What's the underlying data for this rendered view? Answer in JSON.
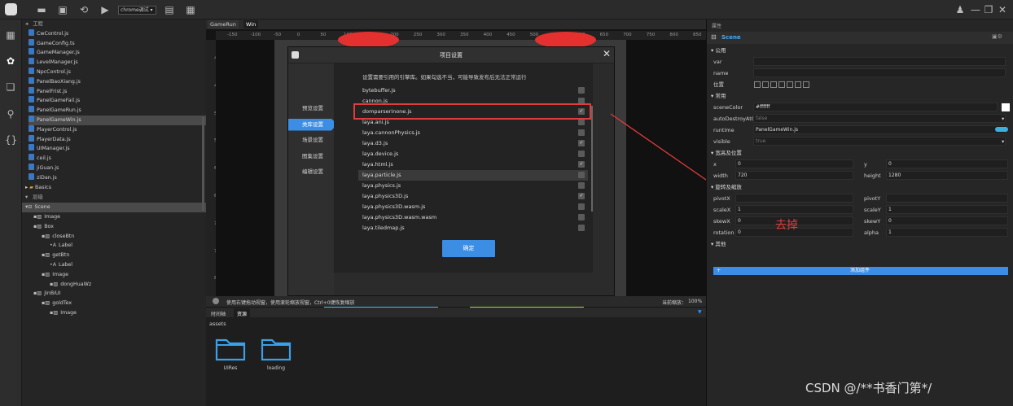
{
  "toolbar": {
    "run_target": "chrome调试 ▾"
  },
  "tree": {
    "section": "工程",
    "files": [
      "CwControl.js",
      "GameConfig.ts",
      "GameManager.js",
      "LevelManager.js",
      "NpcControl.js",
      "PanelBaoXiang.js",
      "PanelFrist.js",
      "PanelGameFail.js",
      "PanelGameRun.js",
      "PanelGameWin.js",
      "PlayerControl.js",
      "PlayerData.js",
      "UIManager.js",
      "ceil.js",
      "jiGuan.js",
      "ziDan.js"
    ],
    "folder": "Basics",
    "layer_section": "层级",
    "layers": [
      "Scene",
      "Image",
      "Box",
      "closeBtn",
      "Label",
      "getBtn",
      "Label",
      "Image",
      "dongHuaWz",
      "JinBiUI",
      "goldTex",
      "Image"
    ]
  },
  "tabs": [
    "GameRun",
    "Win"
  ],
  "ruler": [
    "-150",
    "-100",
    "-50",
    "0",
    "50",
    "100",
    "150",
    "200",
    "250",
    "300",
    "350",
    "400",
    "450",
    "500",
    "550",
    "600",
    "650",
    "700",
    "750",
    "800",
    "850"
  ],
  "vruler": [
    "400",
    "450",
    "500",
    "550",
    "600",
    "650",
    "700",
    "750",
    "800",
    "850"
  ],
  "dialog": {
    "title": "项目设置",
    "nav": [
      "预览设置",
      "类库设置",
      "场景设置",
      "图集设置",
      "编辑设置"
    ],
    "desc": "设置需要引用的引擎库。如果勾选不当，可能导致发布后无法正常运行",
    "libs": [
      [
        "bytebuffer.js",
        false
      ],
      [
        "cannon.js",
        false
      ],
      [
        "domparserinone.js",
        true
      ],
      [
        "laya.ani.js",
        false
      ],
      [
        "laya.cannonPhysics.js",
        false
      ],
      [
        "laya.d3.js",
        true
      ],
      [
        "laya.device.js",
        false
      ],
      [
        "laya.html.js",
        true
      ],
      [
        "laya.particle.js",
        false
      ],
      [
        "laya.physics.js",
        false
      ],
      [
        "laya.physics3D.js",
        true
      ],
      [
        "laya.physics3D.wasm.js",
        false
      ],
      [
        "laya.physics3D.wasm.wasm",
        false
      ],
      [
        "laya.tiledmap.js",
        false
      ]
    ],
    "ok": "确定"
  },
  "status": {
    "hint": "使用右键拖动视窗，使用滚轮缩放视窗，Ctrl+0键恢复缩放",
    "zoom_label": "当前缩放：",
    "zoom": "100%"
  },
  "bottom": {
    "tabs": [
      "时间轴",
      "资源"
    ],
    "path": "assets",
    "folders": [
      "UIRes",
      "loading"
    ]
  },
  "props": {
    "tab": "属性",
    "node": "Scene",
    "g1": "公用",
    "var": "var",
    "name": "name",
    "pos": "位置",
    "g2": "常用",
    "sceneColor": "sceneColor",
    "sceneColor_val": "#ffffff",
    "autoDestroy": "autoDestroyAtC",
    "autoDestroy_val": "false",
    "runtime": "runtime",
    "runtime_val": "PanelGameWin.js",
    "visible": "visible",
    "visible_val": "true",
    "g3": "宽高及位置",
    "x": "x",
    "x_val": "0",
    "y": "y",
    "y_val": "0",
    "width": "width",
    "width_val": "720",
    "height": "height",
    "height_val": "1280",
    "g4": "旋转及缩放",
    "pivotX": "pivotX",
    "pivotY": "pivotY",
    "scaleX": "scaleX",
    "scaleX_val": "1",
    "scaleY": "scaleY",
    "scaleY_val": "1",
    "skewX": "skewX",
    "skewX_val": "0",
    "skewY": "skewY",
    "skewY_val": "0",
    "rotation": "rotation",
    "rotation_val": "0",
    "alpha": "alpha",
    "alpha_val": "1",
    "g5": "其他",
    "add": "添加组件"
  },
  "annotation": "去掉",
  "watermark": "CSDN @/**书香门第*/"
}
